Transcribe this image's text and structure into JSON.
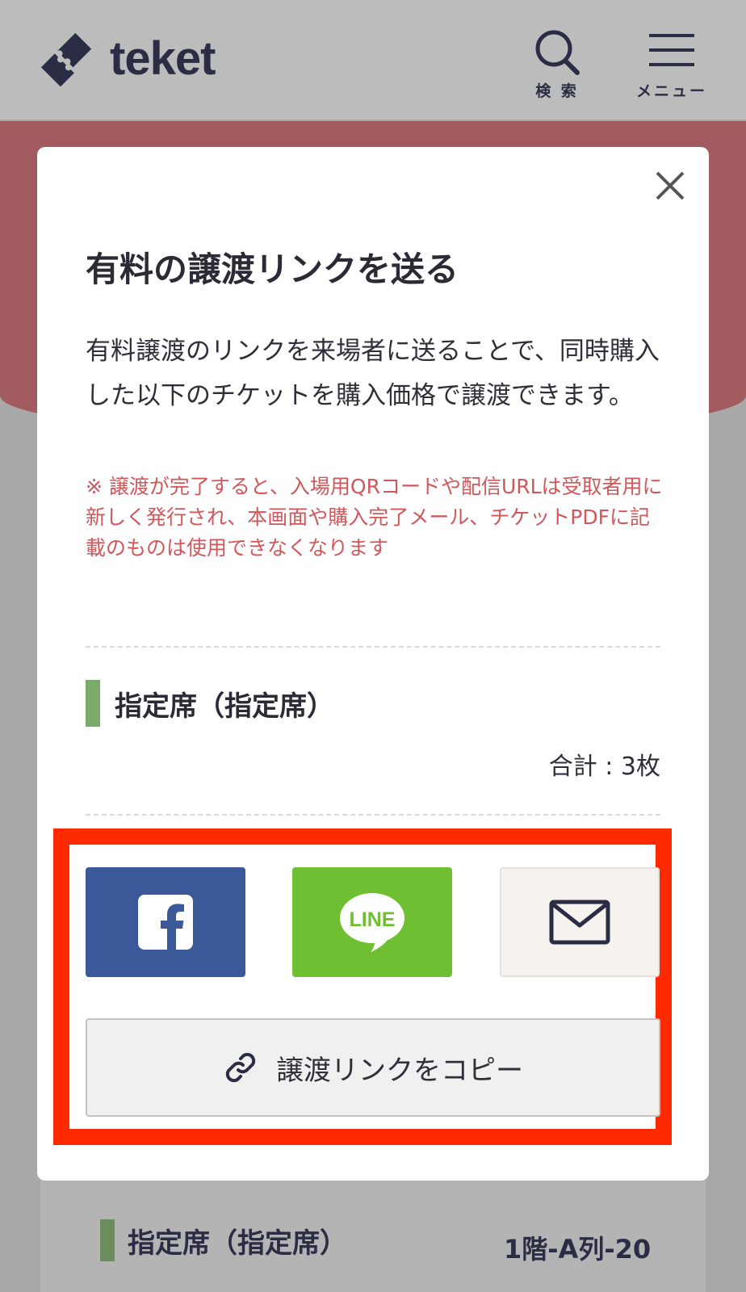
{
  "header": {
    "logo_text": "teket",
    "search_label": "検 索",
    "menu_label": "メニュー"
  },
  "modal": {
    "title": "有料の譲渡リンクを送る",
    "description": "有料譲渡のリンクを来場者に送ることで、同時購入した以下のチケットを購入価格で譲渡できます。",
    "note": "※ 譲渡が完了すると、入場用QRコードや配信URLは受取者用に新しく発行され、本画面や購入完了メール、チケットPDFに記載のものは使用できなくなります",
    "seat_title": "指定席（指定席）",
    "total": "合計 : 3枚",
    "share": {
      "facebook_icon": "facebook-icon",
      "line_label": "LINE",
      "mail_icon": "mail-icon"
    },
    "copy_label": "譲渡リンクをコピー"
  },
  "background": {
    "seat_title": "指定席（指定席）",
    "seat_position": "1階-A列-20"
  },
  "colors": {
    "header_bg": "#bcbcbc",
    "brand_navy": "#2b2d45",
    "backdrop_band": "#a25c5f",
    "facebook": "#3b5998",
    "line": "#6ec032",
    "note_red": "#d2575b",
    "seat_bar": "#7bab6a",
    "highlight_frame": "#ff2a00"
  }
}
